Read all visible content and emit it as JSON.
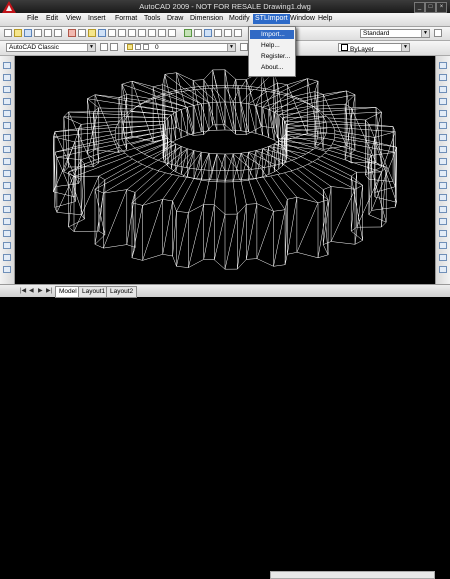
{
  "window": {
    "title": "AutoCAD 2009 - NOT FOR RESALE Drawing1.dwg",
    "controls": [
      "_",
      "□",
      "×"
    ]
  },
  "menubar": {
    "items": [
      "File",
      "Edit",
      "View",
      "Insert",
      "Format",
      "Tools",
      "Draw",
      "Dimension",
      "Modify",
      "STLImport",
      "Window",
      "Help"
    ],
    "active": "STLImport"
  },
  "stl_menu": {
    "items": [
      "Import...",
      "Help...",
      "Register...",
      "About..."
    ]
  },
  "toolbar": {
    "workspace": "AutoCAD Classic",
    "text_style": "Standard",
    "layer_value": "0",
    "color_value": "ByLayer"
  },
  "layout_tabs": [
    "Model",
    "Layout1",
    "Layout2"
  ],
  "colors": {
    "background": "#000000",
    "wireframe": "#ffffff",
    "menu_highlight": "#316ac5"
  }
}
